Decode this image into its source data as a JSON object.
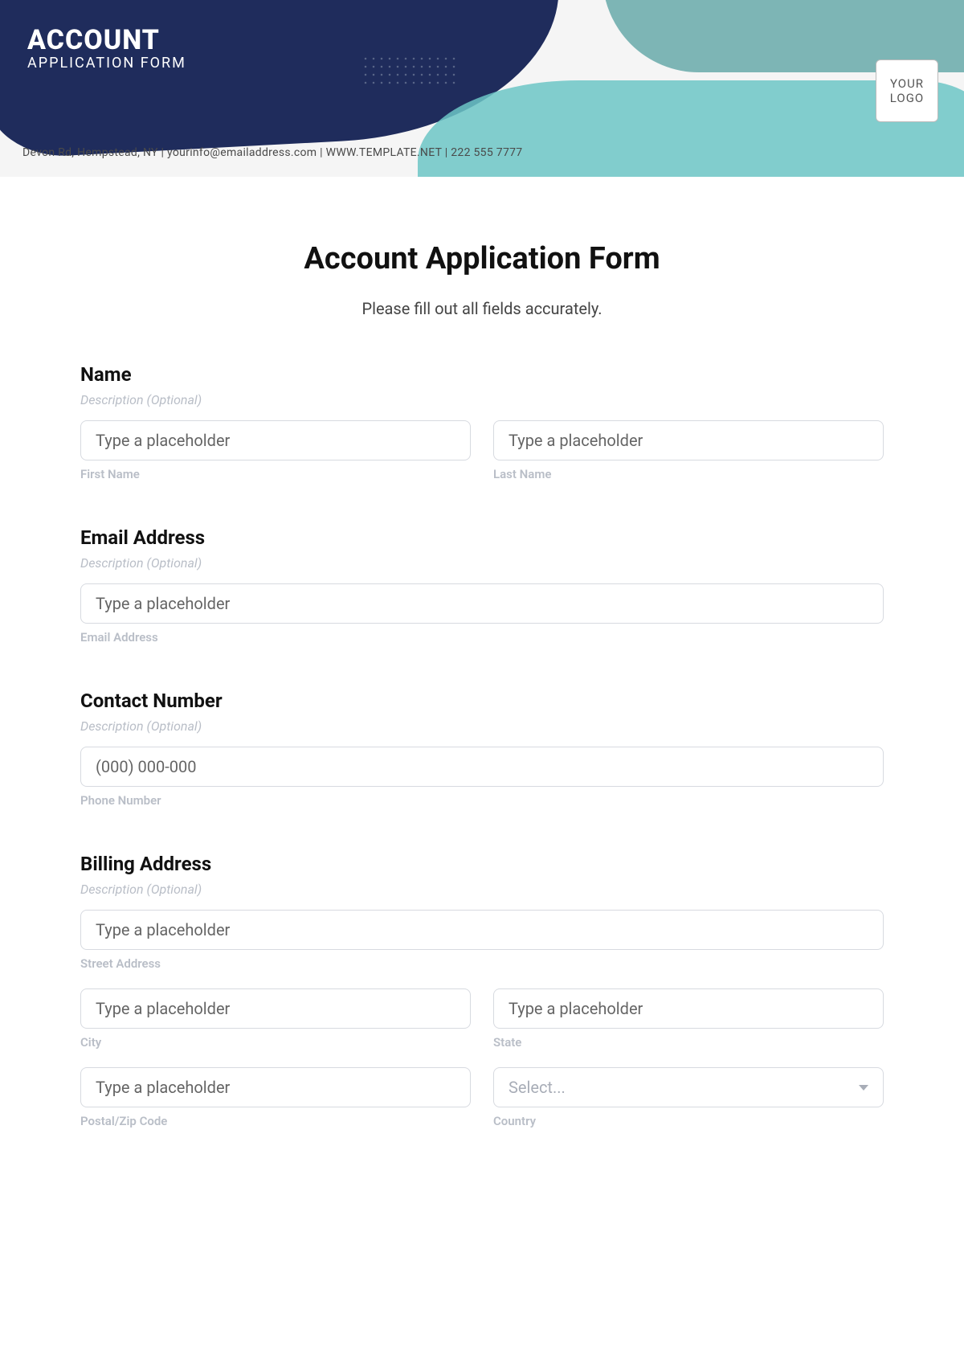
{
  "header": {
    "brand_line_1": "ACCOUNT",
    "brand_line_2": "APPLICATION FORM",
    "logo_text": "YOUR LOGO",
    "contact_line": "Devon Rd, Hempstead, NY | yourinfo@emailaddress.com | WWW.TEMPLATE.NET | 222 555 7777"
  },
  "form": {
    "title": "Account Application Form",
    "instruction": "Please fill out all fields accurately.",
    "sections": {
      "name": {
        "label": "Name",
        "desc": "Description (Optional)",
        "first_placeholder": "Type a placeholder",
        "first_sub": "First Name",
        "last_placeholder": "Type a placeholder",
        "last_sub": "Last Name"
      },
      "email": {
        "label": "Email Address",
        "desc": "Description (Optional)",
        "placeholder": "Type a placeholder",
        "sub": "Email Address"
      },
      "contact": {
        "label": "Contact Number",
        "desc": "Description (Optional)",
        "placeholder": "(000) 000-000",
        "sub": "Phone Number"
      },
      "billing": {
        "label": "Billing Address",
        "desc": "Description (Optional)",
        "street_placeholder": "Type a placeholder",
        "street_sub": "Street Address",
        "city_placeholder": "Type a placeholder",
        "city_sub": "City",
        "state_placeholder": "Type a placeholder",
        "state_sub": "State",
        "postal_placeholder": "Type a placeholder",
        "postal_sub": "Postal/Zip Code",
        "country_placeholder": "Select...",
        "country_sub": "Country"
      }
    }
  }
}
